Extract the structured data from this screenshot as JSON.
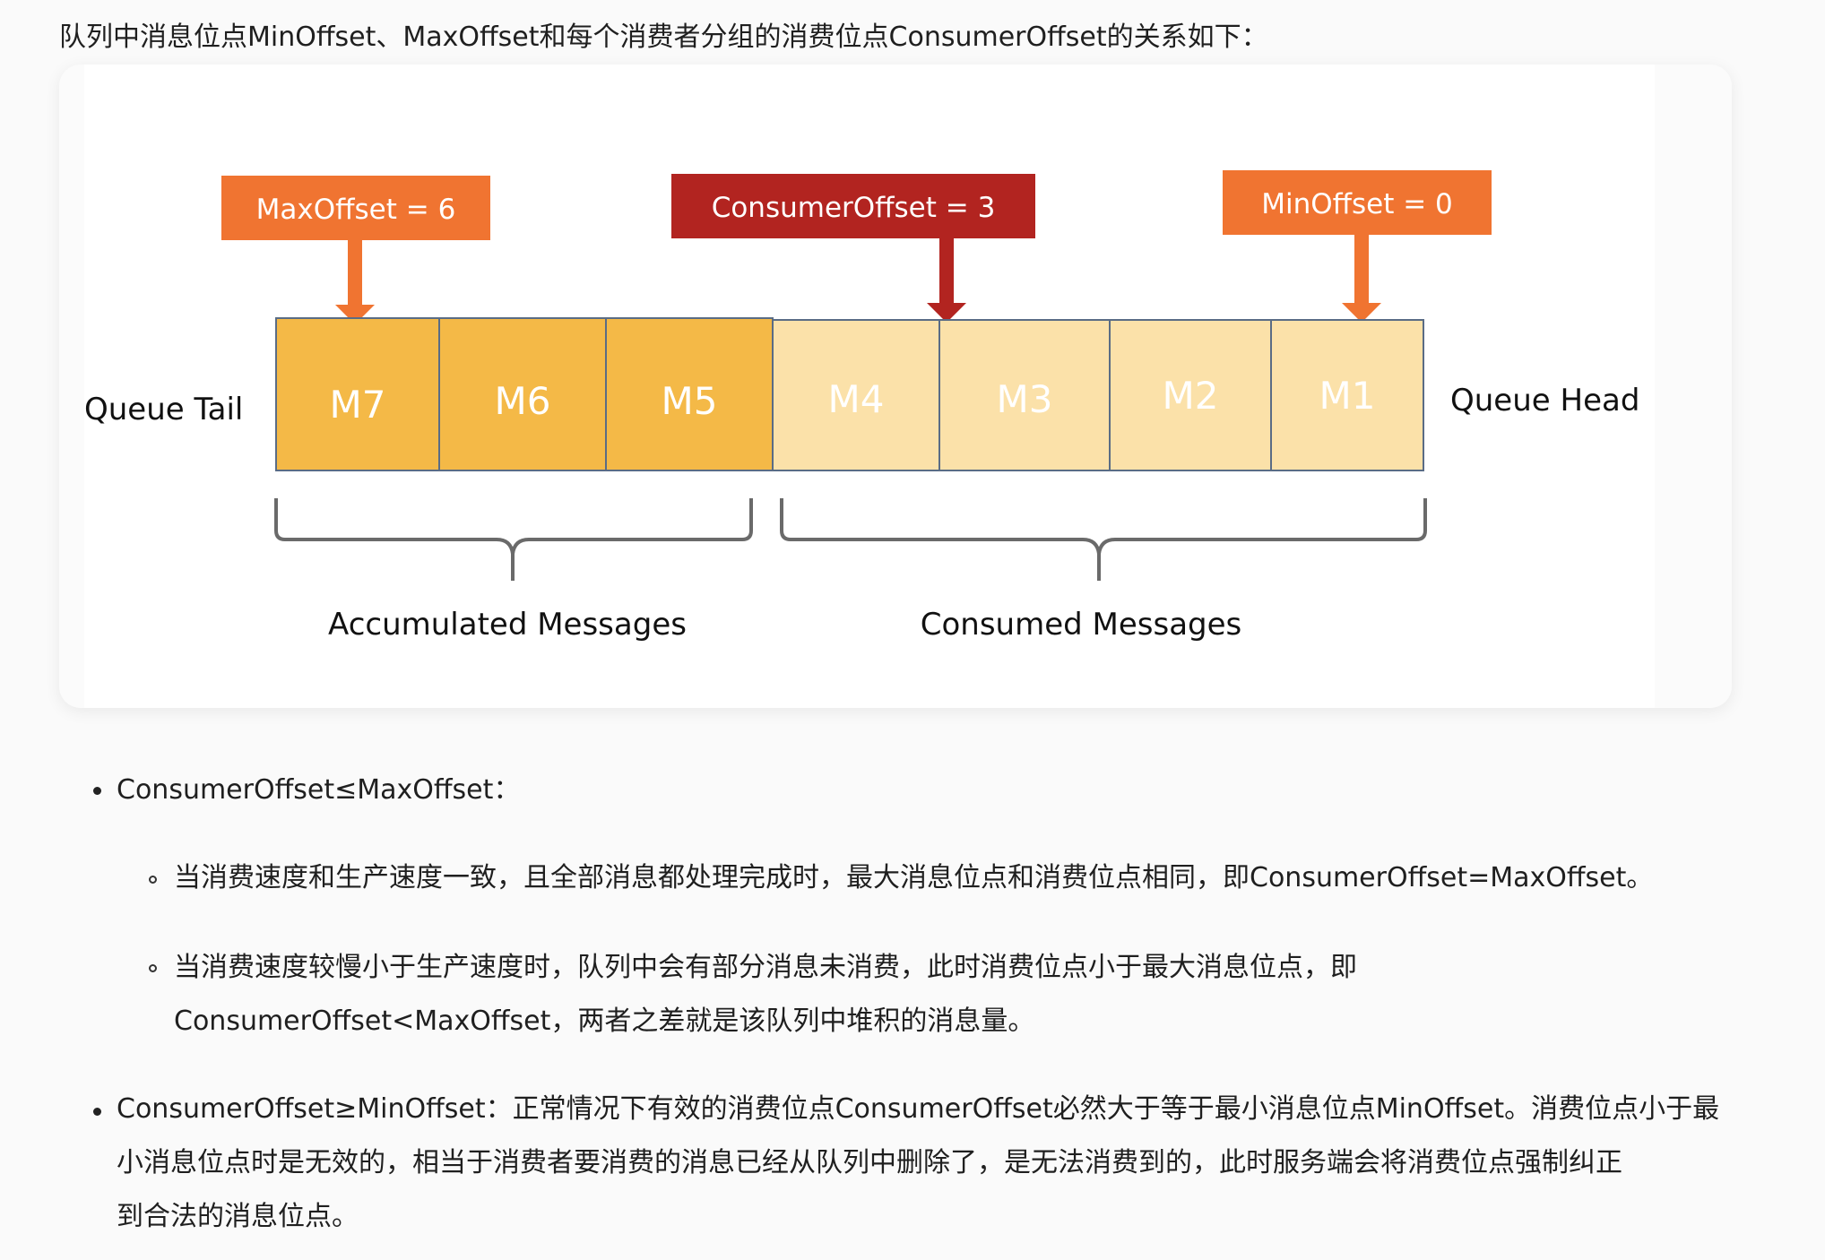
{
  "intro": "队列中消息位点MinOffset、MaxOffset和每个消费者分组的消费位点ConsumerOffset的关系如下：",
  "diagram": {
    "labels": {
      "max_offset": "MaxOffset = 6",
      "consumer_offset": "ConsumerOffset = 3",
      "min_offset": "MinOffset = 0",
      "queue_tail": "Queue Tail",
      "queue_head": "Queue Head",
      "accumulated": "Accumulated Messages",
      "consumed": "Consumed Messages"
    },
    "messages": [
      "M7",
      "M6",
      "M5",
      "M4",
      "M3",
      "M2",
      "M1"
    ],
    "colors": {
      "accumulated_fill": "#f4b947",
      "consumed_fill": "#fbe1a9",
      "orange": "#f07431",
      "dark_red": "#b22420",
      "cell_border": "#5a6c85"
    }
  },
  "bullets": {
    "b1": {
      "text": "ConsumerOffset≤MaxOffset：",
      "sub1": "当消费速度和生产速度一致，且全部消息都处理完成时，最大消息位点和消费位点相同，即ConsumerOffset=MaxOffset。",
      "sub2_line1": "当消费速度较慢小于生产速度时，队列中会有部分消息未消费，此时消费位点小于最大消息位点，即",
      "sub2_line2": "ConsumerOffset<MaxOffset，两者之差就是该队列中堆积的消息量。"
    },
    "b2": {
      "line1": "ConsumerOffset≥MinOffset：正常情况下有效的消费位点ConsumerOffset必然大于等于最小消息位点MinOffset。消费位点小于最",
      "line2": "小消息位点时是无效的，相当于消费者要消费的消息已经从队列中删除了，是无法消费到的，此时服务端会将消费位点强制纠正",
      "line3": "到合法的消息位点。"
    }
  }
}
